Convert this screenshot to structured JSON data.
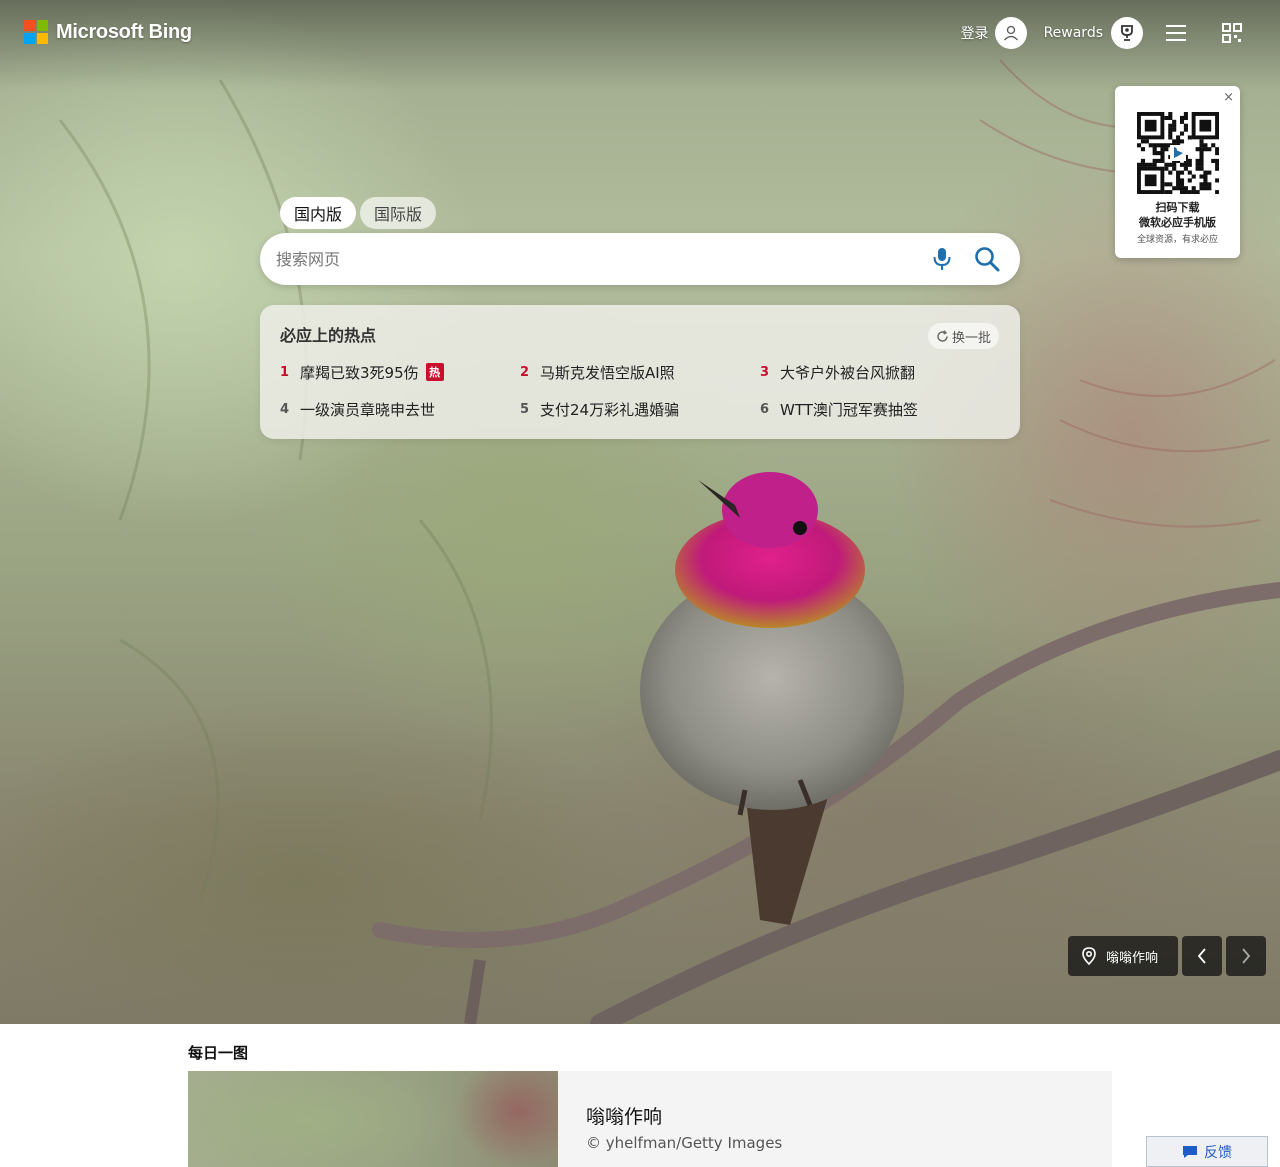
{
  "header": {
    "brand_name": "Microsoft Bing",
    "logo_colors": [
      "#f25022",
      "#7fba00",
      "#00a4ef",
      "#ffb900"
    ],
    "login_label": "登录",
    "rewards_label": "Rewards",
    "icons": [
      "user-icon",
      "rewards-trophy-icon",
      "hamburger-menu-icon",
      "qr-code-icon"
    ]
  },
  "qr_card": {
    "line1": "扫码下载",
    "line2": "微软必应手机版",
    "line3": "全球资源，有求必应",
    "close_glyph": "×"
  },
  "search": {
    "tabs": [
      {
        "label": "国内版",
        "active": true
      },
      {
        "label": "国际版",
        "active": false
      }
    ],
    "placeholder": "搜索网页",
    "accent_color": "#1f6fad"
  },
  "trending": {
    "title": "必应上的热点",
    "refresh_label": "换一批",
    "hot_badge": "热",
    "items": [
      {
        "rank": "1",
        "text": "摩羯已致3死95伤",
        "hot": true
      },
      {
        "rank": "2",
        "text": "马斯克发悟空版AI照",
        "hot": false
      },
      {
        "rank": "3",
        "text": "大爷户外被台风掀翻",
        "hot": false
      },
      {
        "rank": "4",
        "text": "一级演员章晓申去世",
        "hot": false
      },
      {
        "rank": "5",
        "text": "支付24万彩礼遇婚骗",
        "hot": false
      },
      {
        "rank": "6",
        "text": "WTT澳门冠军赛抽签",
        "hot": false
      }
    ]
  },
  "image_nav": {
    "location_label": "嗡嗡作响",
    "prev_glyph": "‹",
    "next_glyph": "›"
  },
  "daily": {
    "heading": "每日一图",
    "title": "嗡嗡作响",
    "credit": "© yhelfman/Getty Images"
  },
  "feedback": {
    "label": "反馈"
  }
}
